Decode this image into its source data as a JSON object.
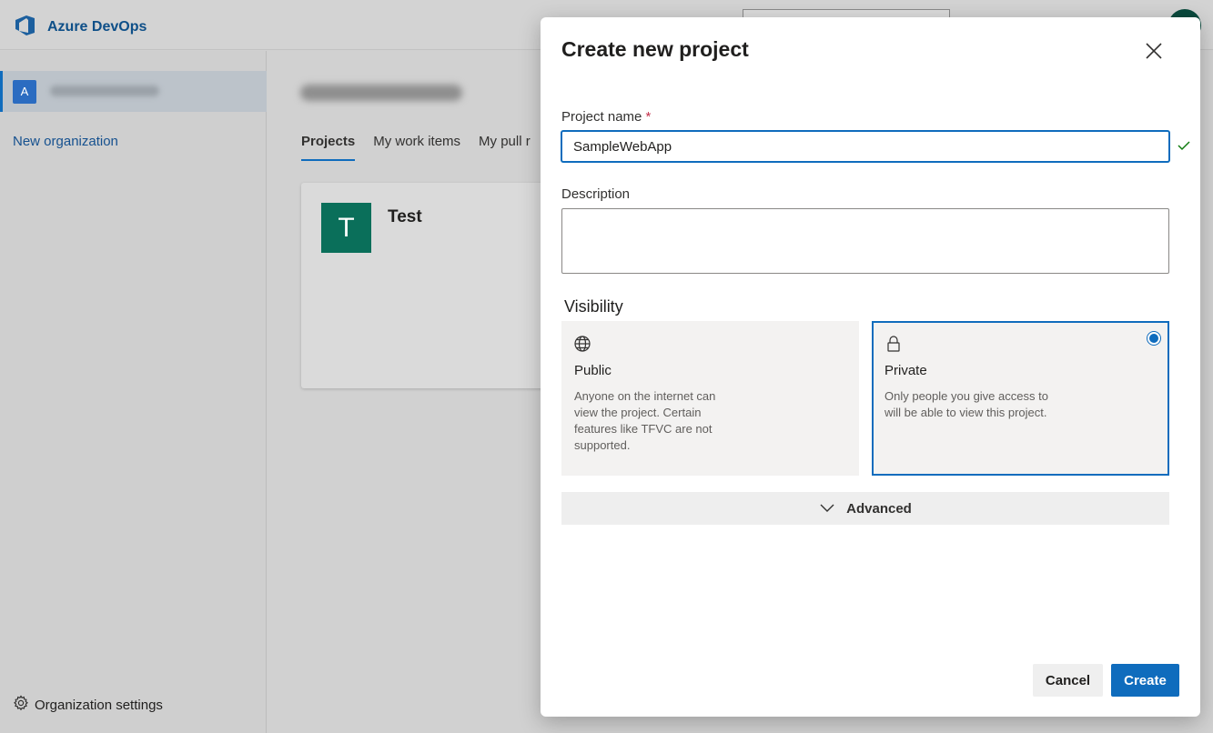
{
  "app": {
    "brand_name": "Azure DevOps",
    "accent_color": "#0f6cbd"
  },
  "sidebar": {
    "org_initial": "A",
    "new_org_label": "New organization",
    "settings_label": "Organization settings"
  },
  "main": {
    "tabs": [
      {
        "label": "Projects",
        "active": true
      },
      {
        "label": "My work items",
        "active": false
      },
      {
        "label": "My pull r",
        "active": false
      }
    ],
    "project_card": {
      "initial": "T",
      "name": "Test",
      "avatar_color": "#0a6f5a"
    }
  },
  "dialog": {
    "title": "Create new project",
    "project_name_label": "Project name",
    "required_marker": "*",
    "project_name_value": "SampleWebApp",
    "description_label": "Description",
    "description_value": "",
    "visibility_label": "Visibility",
    "visibility_options": [
      {
        "icon": "globe-icon",
        "title": "Public",
        "description": "Anyone on the internet can view the project. Certain features like TFVC are not supported.",
        "selected": false
      },
      {
        "icon": "lock-icon",
        "title": "Private",
        "description": "Only people you give access to will be able to view this project.",
        "selected": true
      }
    ],
    "advanced_label": "Advanced",
    "cancel_label": "Cancel",
    "create_label": "Create"
  }
}
